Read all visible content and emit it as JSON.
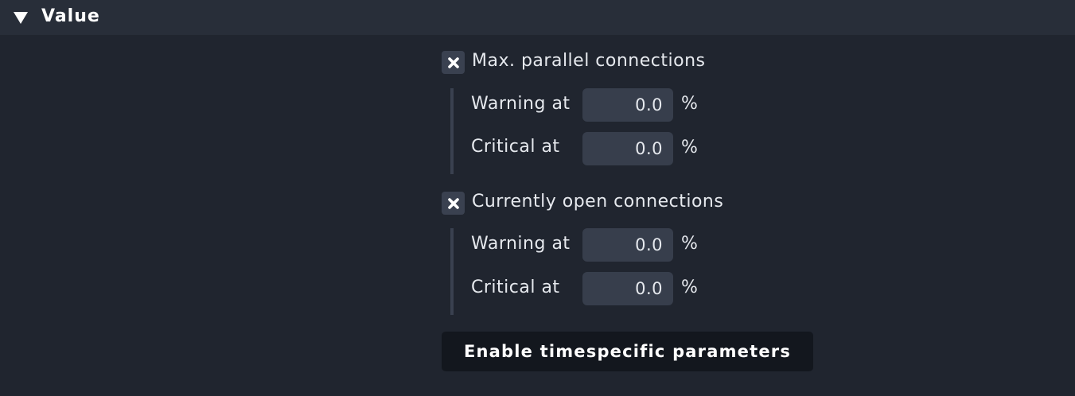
{
  "section": {
    "title": "Value",
    "expanded": true
  },
  "groups": [
    {
      "label": "Max. parallel connections",
      "checked": true,
      "warning": {
        "label": "Warning at",
        "value": "0.0",
        "unit": "%"
      },
      "critical": {
        "label": "Critical at",
        "value": "0.0",
        "unit": "%"
      }
    },
    {
      "label": "Currently open connections",
      "checked": true,
      "warning": {
        "label": "Warning at",
        "value": "0.0",
        "unit": "%"
      },
      "critical": {
        "label": "Critical at",
        "value": "0.0",
        "unit": "%"
      }
    }
  ],
  "enable_button_label": "Enable timespecific parameters",
  "icons": {
    "section_toggle": "triangle-down-icon",
    "checkbox_mark": "x-mark-icon"
  },
  "colors": {
    "background": "#20252f",
    "header_background": "#282e39",
    "input_background": "#373e4c",
    "button_background": "#13171e"
  }
}
